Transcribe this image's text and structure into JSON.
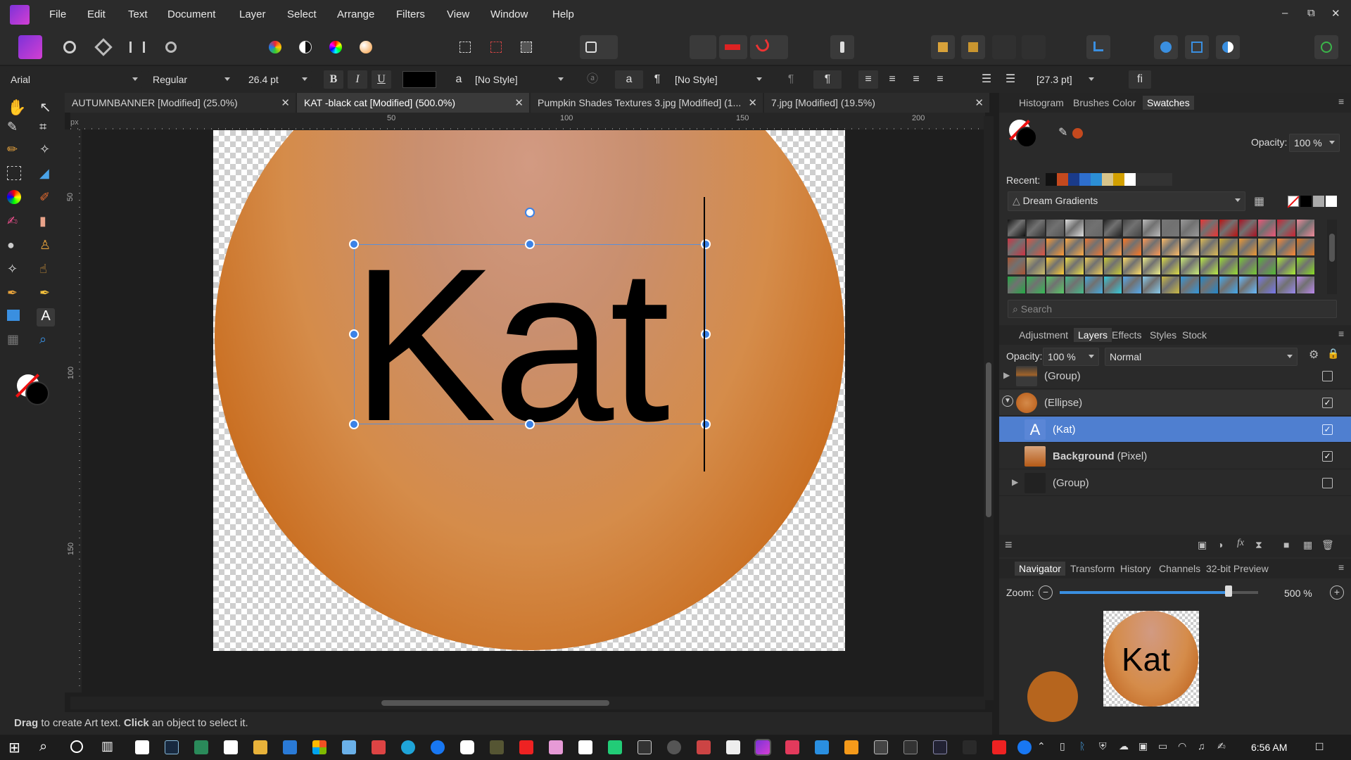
{
  "menu": [
    "File",
    "Edit",
    "Text",
    "Document",
    "Layer",
    "Select",
    "Arrange",
    "Filters",
    "View",
    "Window",
    "Help"
  ],
  "context": {
    "font_family": "Arial",
    "font_style": "Regular",
    "font_size": "26.4 pt",
    "bold": "B",
    "italic": "I",
    "underline": "U",
    "char_glyph": "a",
    "char_style": "[No Style]",
    "para_glyph": "¶",
    "para_style": "[No Style]",
    "leading": "[27.3 pt]",
    "ligature": "fi"
  },
  "tabs": [
    {
      "label": "AUTUMNBANNER [Modified] (25.0%)"
    },
    {
      "label": "KAT -black cat [Modified] (500.0%)"
    },
    {
      "label": "Pumpkin Shades Textures 3.jpg [Modified] (1..."
    },
    {
      "label": "7.jpg [Modified] (19.5%)"
    }
  ],
  "ruler": {
    "unit": "px",
    "top_ticks": [
      "50",
      "100",
      "150",
      "200"
    ],
    "left_ticks": [
      "50",
      "100",
      "150"
    ]
  },
  "canvas": {
    "text": "Kat"
  },
  "status": {
    "bold1": "Drag",
    "text1": " to create Art text. ",
    "bold2": "Click",
    "text2": " an object to select it."
  },
  "swatches_panel": {
    "tabs": [
      "Histogram",
      "Brushes",
      "Color",
      "Swatches"
    ],
    "opacity_label": "Opacity:",
    "opacity_value": "100 %",
    "recent_label": "Recent:",
    "palette_name": "Dream Gradients",
    "search_placeholder": "Search",
    "recent_colors": [
      "#111111",
      "#c4491e",
      "#1a3b8a",
      "#2e6fce",
      "#2c8fd6",
      "#d7c48a",
      "#d2a000",
      "#ffffff"
    ]
  },
  "layers_panel": {
    "tabs": [
      "Adjustment",
      "Layers",
      "Effects",
      "Styles",
      "Stock"
    ],
    "opacity_label": "Opacity:",
    "opacity_value": "100 %",
    "blend_mode": "Normal",
    "layers": [
      {
        "name": "(Group)"
      },
      {
        "name": "(Ellipse)"
      },
      {
        "name": "(Kat)"
      },
      {
        "name_bold": "Background",
        "name_rest": " (Pixel)"
      },
      {
        "name": "(Group)"
      }
    ]
  },
  "navigator_panel": {
    "tabs": [
      "Navigator",
      "Transform",
      "History",
      "Channels",
      "32-bit Preview"
    ],
    "zoom_label": "Zoom:",
    "zoom_value": "500 %",
    "preview_text": "Kat"
  },
  "taskbar": {
    "time": "6:56 AM"
  },
  "colors": {
    "accent": "#4f7fd0",
    "handle": "#3b82e6",
    "affinity": "#8b3dd6"
  }
}
